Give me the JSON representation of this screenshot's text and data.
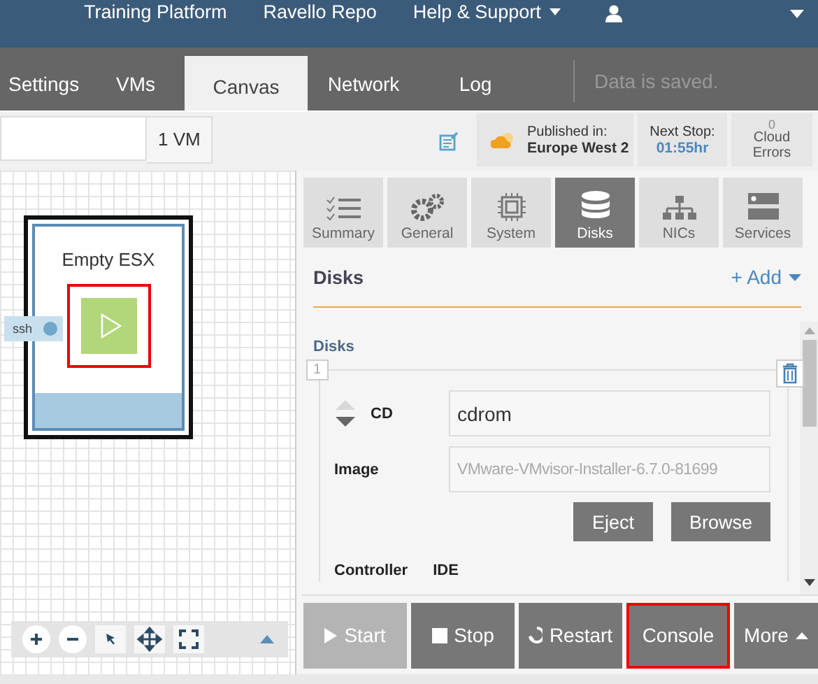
{
  "nav": {
    "items": [
      {
        "label": "Training Platform",
        "dropdown": false
      },
      {
        "label": "Ravello Repo",
        "dropdown": false
      },
      {
        "label": "Help & Support",
        "dropdown": true
      }
    ]
  },
  "tabs": [
    {
      "label": "Settings",
      "selected": false
    },
    {
      "label": "VMs",
      "selected": false
    },
    {
      "label": "Canvas",
      "selected": true
    },
    {
      "label": "Network",
      "selected": false
    },
    {
      "label": "Log",
      "selected": false
    }
  ],
  "save_status": "Data is saved.",
  "toolbar": {
    "vm_count": "1 VM",
    "published_label": "Published in:",
    "published_value": "Europe West 2",
    "next_stop_label": "Next Stop:",
    "next_stop_value": "01:55hr",
    "errors_count": "0",
    "errors_label": "Cloud Errors"
  },
  "canvas": {
    "vm": {
      "name": "Empty ESX",
      "selected": true,
      "port": "ssh"
    }
  },
  "panel_tabs": [
    {
      "label": "Summary",
      "kind": "list",
      "selected": false
    },
    {
      "label": "General",
      "kind": "gears",
      "selected": false
    },
    {
      "label": "System",
      "kind": "chip",
      "selected": false
    },
    {
      "label": "Disks",
      "kind": "stack",
      "selected": true
    },
    {
      "label": "NICs",
      "kind": "network",
      "selected": false
    },
    {
      "label": "Services",
      "kind": "server",
      "selected": false
    }
  ],
  "section": {
    "title": "Disks",
    "add": "+ Add"
  },
  "disks": {
    "label": "Disks",
    "items": [
      {
        "index": "1",
        "type": "CD",
        "name": "cdrom",
        "image_label": "Image",
        "image": "VMware-VMvisor-Installer-6.7.0-81699",
        "buttons": [
          "Eject",
          "Browse"
        ],
        "controller_label": "Controller",
        "controller": "IDE"
      }
    ]
  },
  "actions": [
    {
      "label": "Start",
      "kind": "play",
      "disabled": true,
      "highlighted": false
    },
    {
      "label": "Stop",
      "kind": "stop",
      "disabled": false,
      "highlighted": false
    },
    {
      "label": "Restart",
      "kind": "restart",
      "disabled": false,
      "highlighted": false
    },
    {
      "label": "Console",
      "kind": "plain",
      "disabled": false,
      "highlighted": true
    },
    {
      "label": "More",
      "kind": "menu",
      "disabled": false,
      "highlighted": false
    }
  ]
}
